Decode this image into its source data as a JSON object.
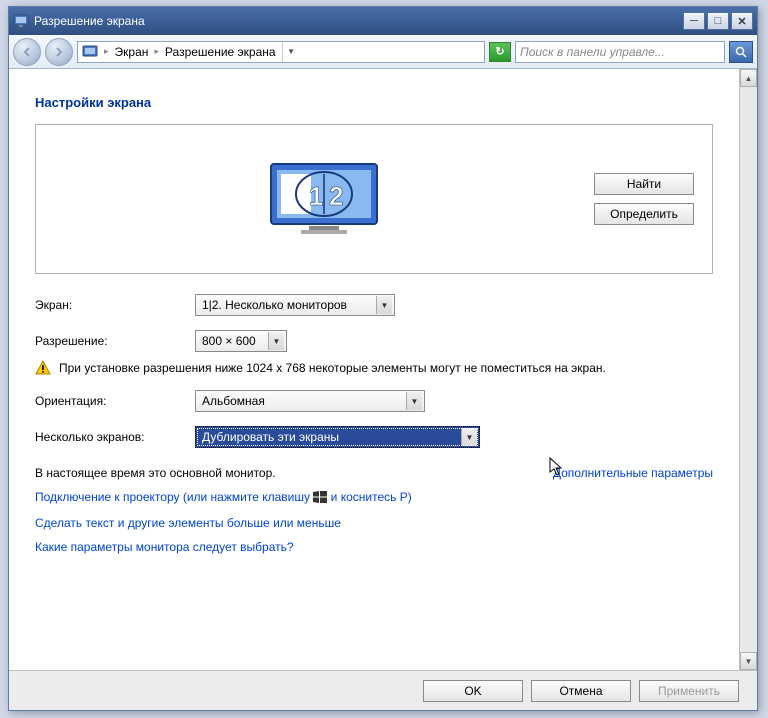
{
  "window": {
    "title": "Разрешение экрана"
  },
  "breadcrumb": {
    "item1": "Экран",
    "item2": "Разрешение экрана"
  },
  "search": {
    "placeholder": "Поиск в панели управле..."
  },
  "heading": "Настройки экрана",
  "buttons": {
    "find": "Найти",
    "identify": "Определить",
    "ok": "OK",
    "cancel": "Отмена",
    "apply": "Применить"
  },
  "form": {
    "screen_label": "Экран:",
    "screen_value": "1|2. Несколько мониторов",
    "resolution_label": "Разрешение:",
    "resolution_value": "800 × 600",
    "orientation_label": "Ориентация:",
    "orientation_value": "Альбомная",
    "multi_label": "Несколько экранов:",
    "multi_value": "Дублировать эти экраны"
  },
  "warning": "При установке разрешения ниже 1024 х 768 некоторые элементы могут не поместиться на экран.",
  "primary_text": "В настоящее время это основной монитор.",
  "advanced_link": "Дополнительные параметры",
  "projector_link_pre": "Подключение к проектору (или нажмите клавишу",
  "projector_link_post": "и коснитесь P)",
  "textsize_link": "Сделать текст и другие элементы больше или меньше",
  "help_link": "Какие параметры монитора следует выбрать?"
}
